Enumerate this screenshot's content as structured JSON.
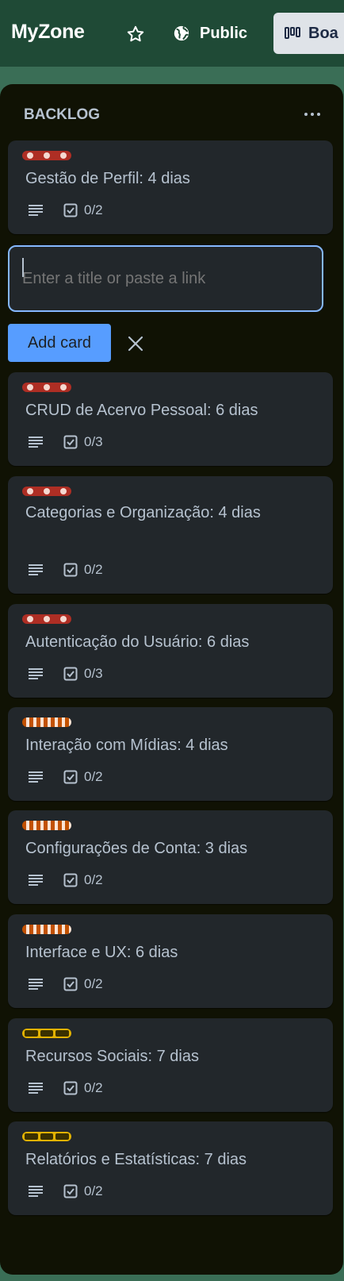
{
  "header": {
    "board_title": "MyZone",
    "visibility_label": "Public",
    "view_label": "Boa"
  },
  "list": {
    "title": "BACKLOG",
    "composer_placeholder": "Enter a title or paste a link",
    "add_card_label": "Add card"
  },
  "colors": {
    "label_red": "#ae2e24",
    "label_orange": "#c25100",
    "label_yellow": "#e2b203",
    "add_button": "#579dff",
    "list_background": "#101204",
    "card_background": "#22272b"
  },
  "icons": {
    "star": "star-icon",
    "globe": "globe-icon",
    "board": "board-icon",
    "more": "more-icon",
    "close": "close-icon",
    "description": "description-icon",
    "checklist": "checklist-icon"
  },
  "cards": [
    {
      "label": "red",
      "title": "Gestão de Perfil: 4 dias",
      "checklist": "0/2"
    },
    {
      "label": "red",
      "title": "CRUD de Acervo Pessoal: 6 dias",
      "checklist": "0/3"
    },
    {
      "label": "red",
      "title": "Categorias e Organização: 4 dias",
      "checklist": "0/2"
    },
    {
      "label": "red",
      "title": "Autenticação do Usuário: 6 dias",
      "checklist": "0/3"
    },
    {
      "label": "orange",
      "title": "Interação com Mídias: 4 dias",
      "checklist": "0/2"
    },
    {
      "label": "orange",
      "title": "Configurações de Conta: 3 dias",
      "checklist": "0/2"
    },
    {
      "label": "orange",
      "title": "Interface e UX: 6 dias",
      "checklist": "0/2"
    },
    {
      "label": "yellow",
      "title": "Recursos Sociais: 7 dias",
      "checklist": "0/2"
    },
    {
      "label": "yellow",
      "title": "Relatórios e Estatísticas: 7 dias",
      "checklist": "0/2"
    }
  ]
}
